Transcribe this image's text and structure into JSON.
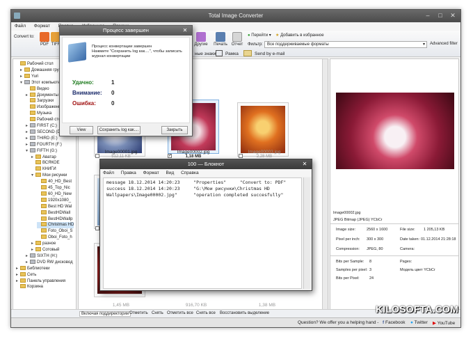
{
  "app": {
    "title": "Total Image Converter",
    "menu": [
      "Файл",
      "Формат",
      "Правка",
      "Избранное",
      "Помощь"
    ]
  },
  "toolbar": {
    "convert_to_label": "Convert to:",
    "pdf": "PDF",
    "tiff": "TIFF",
    "other": "Другие",
    "print": "Печать",
    "report": "Отчет",
    "goto": "Перейти",
    "add_fav": "Добавить в избранное",
    "filter_label": "Фильтр:",
    "filter_value": "Все поддерживаемые форматы",
    "advanced_filter": "Advanced filter",
    "watermark": "ные знаки",
    "frame": "Рамка",
    "email": "Send by e-mail"
  },
  "sidebar": {
    "items": [
      "Рабочий стол",
      "Домашняя группа",
      "Yuri",
      "Этот компьютер",
      "Видео",
      "Документы",
      "Загрузки",
      "Изображения",
      "Музыка",
      "Рабочий стол",
      "FIRST (C:)",
      "SECOND (D:)",
      "THIRD (E:)",
      "FOURTH (F:)",
      "FIFTH (G:)",
      "Аватар",
      "ВСЯКОЕ",
      "КНИГИ",
      "Мои рисунки",
      "40_HD_Best",
      "45_Top_Nic",
      "60_HD_New",
      "1920x1080_",
      "Best HD Wal",
      "BestHDWall",
      "BestHDWallp",
      "Christmas HD",
      "Foto_Oboi_S",
      "Oboi_Foto_h",
      "разное",
      "Сотовый",
      "SIXTH (H:)",
      "DVD RW дисковод",
      "Библиотеки",
      "Сеть",
      "Панель управления",
      "Корзина"
    ]
  },
  "thumbnails": [
    {
      "name": "Image00001.jpg",
      "size": "512,11 KB",
      "checked": false
    },
    {
      "name": "Image00002.jpg",
      "size": "1,18 MB",
      "checked": true
    },
    {
      "name": "Image00003.jpg",
      "size": "2,28 MB",
      "checked": false
    }
  ],
  "bottom_row_sizes": [
    "1,45 MB",
    "916,70 KB",
    "1,38 MB"
  ],
  "bottom_actions": {
    "include_sub": "Включая поддиректории",
    "check": "Отметить",
    "uncheck": "Снять",
    "check_all": "Отметить все",
    "uncheck_all": "Снять все",
    "restore": "Восстановить выделение"
  },
  "preview": {
    "filename": "Image00002.jpg",
    "filetype": "JPEG Bitmap (JPEG) YCbCr",
    "image_size_label": "Image size:",
    "image_size": "2560 x 1600",
    "file_size_label": "File size:",
    "file_size": "1 205,13 KB",
    "ppi_label": "Pixel per inch:",
    "ppi": "300 x 300",
    "date_label": "Date taken:",
    "date": "01.12.2014 21:28:18",
    "compression_label": "Compression:",
    "compression": "JPEG, 80",
    "camera_label": "Camera:",
    "bps_label": "Bits per Sample:",
    "bps": "8",
    "pages_label": "Pages:",
    "spp_label": "Samples per pixel:",
    "spp": "3",
    "model": "Модель цвет YCbCr",
    "bpp_label": "Bits per Pixel:",
    "bpp": "24"
  },
  "status": {
    "question": "Question? We offer you a helping hand -",
    "facebook": "Facebook",
    "twitter": "Twitter",
    "youtube": "YouTube"
  },
  "logo": "KILOSOFTA.COM",
  "dialog_done": {
    "title": "Процесс завершен",
    "message": "Процесс конвертации завершен\nНажмите \"Сохранить log как....\", чтобы записать журнал конвертации",
    "success_label": "Удачно:",
    "success_value": "1",
    "warning_label": "Внимание:",
    "warning_value": "0",
    "error_label": "Ошибка:",
    "error_value": "0",
    "view": "View",
    "save_log": "Сохранить log как....",
    "close": "Закрыть"
  },
  "notepad": {
    "title": "100 — Блокнот",
    "menu": [
      "Файл",
      "Правка",
      "Формат",
      "Вид",
      "Справка"
    ],
    "lines": [
      "message 18.12.2014 14:20:23     \"Properties\"     \"Convert to: PDF\"",
      "success 18.12.2014 14:20:23     \"G:\\Мои рисунки\\Christmas HD",
      "Wallpapers\\Image00002.jpg\"      \"operation completed succesfully\""
    ]
  },
  "colors": {
    "accent": "#3b7fd0",
    "success": "#1c7a1c",
    "error": "#a01010"
  }
}
